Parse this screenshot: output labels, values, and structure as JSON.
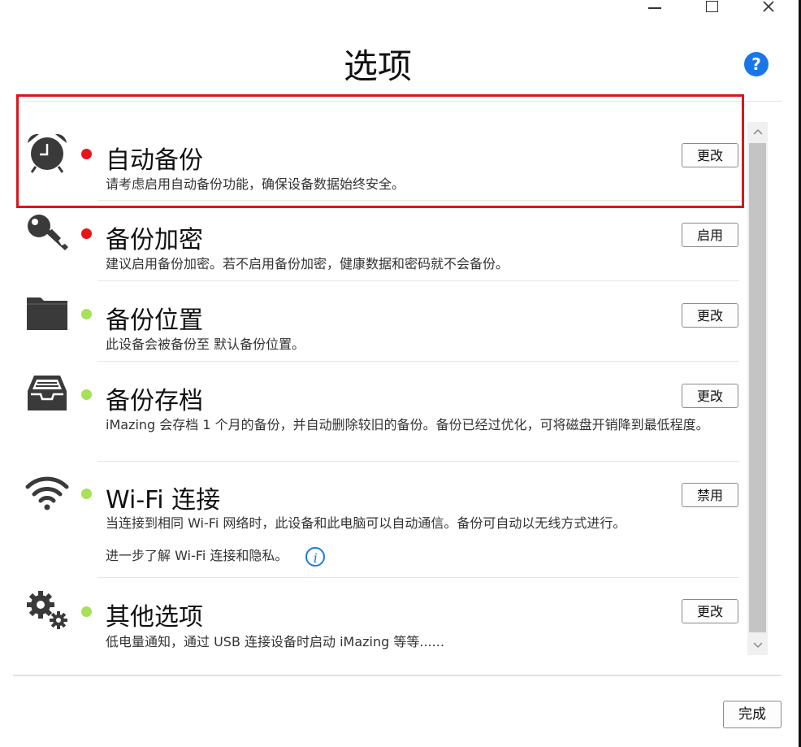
{
  "window": {
    "minimize_label": "–",
    "maximize_label": "□",
    "close_label": "×"
  },
  "header": {
    "title": "选项",
    "help_label": "?"
  },
  "options": [
    {
      "title": "自动备份",
      "desc": "请考虑启用自动备份功能，确保设备数据始终安全。",
      "button": "更改",
      "status": "red",
      "icon": "alarm-clock-icon"
    },
    {
      "title": "备份加密",
      "desc": "建议启用备份加密。若不启用备份加密，健康数据和密码就不会备份。",
      "button": "启用",
      "status": "red",
      "icon": "key-icon"
    },
    {
      "title": "备份位置",
      "desc": "此设备会被备份至 默认备份位置。",
      "button": "更改",
      "status": "green",
      "icon": "folder-icon"
    },
    {
      "title": "备份存档",
      "desc": "iMazing 会存档 1 个月的备份，并自动删除较旧的备份。备份已经过优化，可将磁盘开销降到最低程度。",
      "button": "更改",
      "status": "green",
      "icon": "archive-tray-icon"
    },
    {
      "title": "Wi-Fi 连接",
      "desc": "当连接到相同 Wi-Fi 网络时，此设备和此电脑可以自动通信。备份可自动以无线方式进行。",
      "link": "进一步了解 Wi-Fi 连接和隐私。",
      "button": "禁用",
      "status": "green",
      "icon": "wifi-icon"
    },
    {
      "title": "其他选项",
      "desc": "低电量通知，通过 USB 连接设备时启动 iMazing 等等......",
      "button": "更改",
      "status": "green",
      "icon": "gears-icon"
    }
  ],
  "colors": {
    "status_red": "#e8141a",
    "status_green": "#a8e05a",
    "accent_blue": "#1877e8",
    "highlight_red": "#d9161a"
  },
  "footer": {
    "done_label": "完成"
  }
}
